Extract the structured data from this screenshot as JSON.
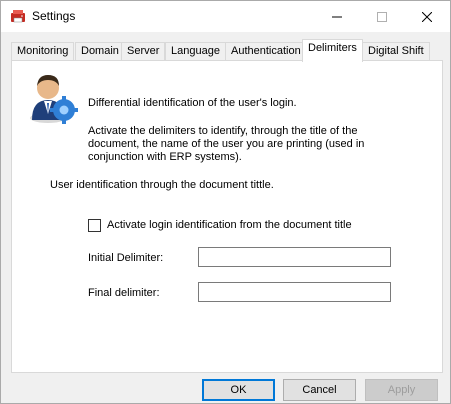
{
  "window": {
    "title": "Settings",
    "controls": {
      "minimize": "minimize-icon",
      "maximize": "maximize-icon",
      "close": "close-icon"
    }
  },
  "tabs": [
    {
      "label": "Monitoring"
    },
    {
      "label": "Domain"
    },
    {
      "label": "Server"
    },
    {
      "label": "Language"
    },
    {
      "label": "Authentication"
    },
    {
      "label": "Delimiters",
      "selected": true
    },
    {
      "label": "Digital Shift"
    }
  ],
  "panel": {
    "heading": "Differential identification of the user's login.",
    "description": "Activate the delimiters to identify, through the title of the document, the name of the user you are printing (used in conjunction with ERP systems).",
    "section_label": "User identification through the document tittle.",
    "checkbox": {
      "label": "Activate login identification from the document title",
      "checked": false
    },
    "initial_delimiter": {
      "label": "Initial Delimiter:",
      "value": ""
    },
    "final_delimiter": {
      "label": "Final delimiter:",
      "value": ""
    }
  },
  "buttons": {
    "ok": "OK",
    "cancel": "Cancel",
    "apply": "Apply",
    "apply_enabled": false
  },
  "colors": {
    "focus_border": "#0078d7",
    "app_icon_red": "#d9342b"
  }
}
